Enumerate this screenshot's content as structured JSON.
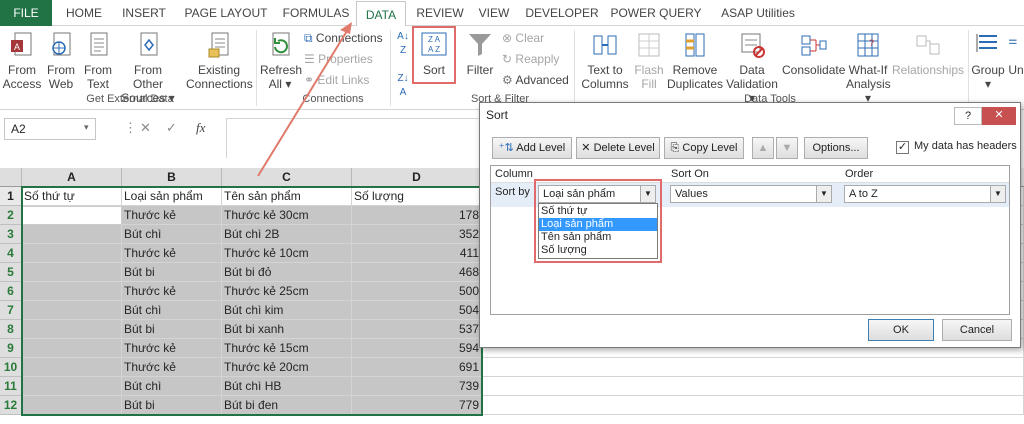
{
  "tabs": [
    "FILE",
    "HOME",
    "INSERT",
    "PAGE LAYOUT",
    "FORMULAS",
    "DATA",
    "REVIEW",
    "VIEW",
    "DEVELOPER",
    "POWER QUERY",
    "ASAP Utilities"
  ],
  "ribbon": {
    "from_access": [
      "From",
      "Access"
    ],
    "from_web": [
      "From",
      "Web"
    ],
    "from_text": [
      "From",
      "Text"
    ],
    "from_other": [
      "From Other",
      "Sources"
    ],
    "existing": [
      "Existing",
      "Connections"
    ],
    "group_external": "Get External Data",
    "refresh": [
      "Refresh",
      "All"
    ],
    "connections": "Connections",
    "properties": "Properties",
    "edit_links": "Edit Links",
    "group_connections": "Connections",
    "sort": "Sort",
    "filter": "Filter",
    "clear": "Clear",
    "reapply": "Reapply",
    "advanced": "Advanced",
    "group_sort": "Sort & Filter",
    "text_to_columns": [
      "Text to",
      "Columns"
    ],
    "flash_fill": [
      "Flash",
      "Fill"
    ],
    "remove_dup": [
      "Remove",
      "Duplicates"
    ],
    "data_validation": [
      "Data",
      "Validation"
    ],
    "consolidate": "Consolidate",
    "what_if": [
      "What-If",
      "Analysis"
    ],
    "relationships": "Relationships",
    "group_tools": "Data Tools",
    "group": "Group",
    "ungroup": "Un"
  },
  "namebox": "A2",
  "columns": [
    "A",
    "B",
    "C",
    "D"
  ],
  "headers": [
    "Số thứ tự",
    "Loại sản phẩm",
    "Tên sản phẩm",
    "Số lượng"
  ],
  "rows": [
    [
      "",
      "Thước kẻ",
      "Thước kẻ 30cm",
      "178"
    ],
    [
      "",
      "Bút chì",
      "Bút chì 2B",
      "352"
    ],
    [
      "",
      "Thước kẻ",
      "Thước kẻ 10cm",
      "411"
    ],
    [
      "",
      "Bút bi",
      "Bút bi đỏ",
      "468"
    ],
    [
      "",
      "Thước kẻ",
      "Thước kẻ 25cm",
      "500"
    ],
    [
      "",
      "Bút chì",
      "Bút chì kim",
      "504"
    ],
    [
      "",
      "Bút bi",
      "Bút bi xanh",
      "537"
    ],
    [
      "",
      "Thước kẻ",
      "Thước kẻ 15cm",
      "594"
    ],
    [
      "",
      "Thước kẻ",
      "Thước kẻ 20cm",
      "691"
    ],
    [
      "",
      "Bút chì",
      "Bút chì HB",
      "739"
    ],
    [
      "",
      "Bút bi",
      "Bút bi đen",
      "779"
    ]
  ],
  "dialog": {
    "title": "Sort",
    "add_level": "Add Level",
    "delete_level": "Delete Level",
    "copy_level": "Copy Level",
    "options": "Options...",
    "headers_check": "My data has headers",
    "col_column": "Column",
    "col_sort_on": "Sort On",
    "col_order": "Order",
    "sort_by": "Sort by",
    "column_value": "Loại sản phẩm",
    "sort_on_value": "Values",
    "order_value": "A to Z",
    "list": [
      "Số thứ tự",
      "Loại sản phẩm",
      "Tên sản phẩm",
      "Số lượng"
    ],
    "ok": "OK",
    "cancel": "Cancel",
    "help": "?",
    "close": "✕"
  }
}
